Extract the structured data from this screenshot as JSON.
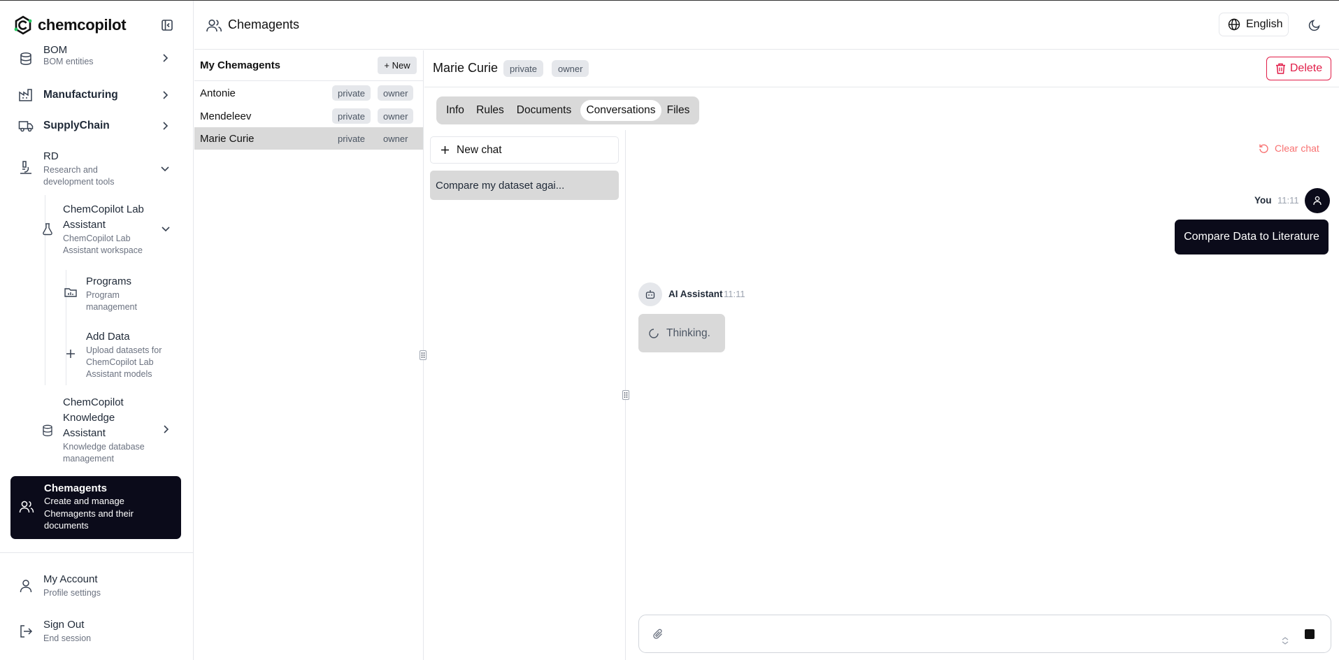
{
  "app": {
    "brand": "chemcopilot",
    "page_title": "Chemagents"
  },
  "header": {
    "language": "English"
  },
  "sidebar": {
    "items": [
      {
        "title": "BOM",
        "subtitle": "BOM entities"
      },
      {
        "title": "Manufacturing",
        "subtitle": ""
      },
      {
        "title": "SupplyChain",
        "subtitle": ""
      },
      {
        "title": "RD",
        "subtitle": "Research and development tools"
      },
      {
        "title": "ChemCopilot Lab Assistant",
        "subtitle": "ChemCopilot Lab Assistant workspace"
      },
      {
        "title": "Programs",
        "subtitle": "Program management"
      },
      {
        "title": "Add Data",
        "subtitle": "Upload datasets for ChemCopilot Lab Assistant models"
      },
      {
        "title": "ChemCopilot Knowledge Assistant",
        "subtitle": "Knowledge database management"
      },
      {
        "title": "Chemagents",
        "subtitle": "Create and manage Chemagents and their documents"
      }
    ],
    "footer": [
      {
        "title": "My Account",
        "subtitle": "Profile settings"
      },
      {
        "title": "Sign Out",
        "subtitle": "End session"
      }
    ]
  },
  "agents": {
    "title": "My Chemagents",
    "new_label": "+ New",
    "list": [
      {
        "name": "Antonie",
        "visibility": "private",
        "role": "owner"
      },
      {
        "name": "Mendeleev",
        "visibility": "private",
        "role": "owner"
      },
      {
        "name": "Marie Curie",
        "visibility": "private",
        "role": "owner"
      }
    ]
  },
  "detail": {
    "name": "Marie Curie",
    "visibility": "private",
    "role": "owner",
    "delete_label": "Delete",
    "tabs": [
      "Info",
      "Rules",
      "Documents",
      "Conversations",
      "Files"
    ],
    "active_tab": "Conversations"
  },
  "conversations": {
    "new_chat_label": "New chat",
    "items": [
      "Compare my dataset agai..."
    ]
  },
  "chat": {
    "clear_label": "Clear chat",
    "messages": [
      {
        "sender": "You",
        "time": "11:11",
        "text": "Compare Data to Literature"
      },
      {
        "sender": "AI Assistant",
        "time": "11:11",
        "text": "Thinking."
      }
    ],
    "input_value": "",
    "input_placeholder": ""
  },
  "colors": {
    "accent_dark": "#0b0b1a",
    "danger": "#e11d48",
    "muted_bg": "#d9d9d9",
    "clear_chat": "#f87171"
  }
}
